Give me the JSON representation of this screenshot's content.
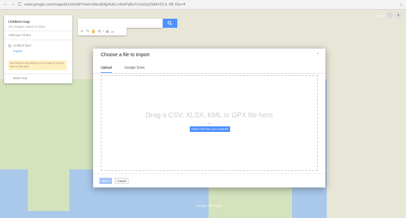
{
  "browser": {
    "url": "www.google.com/maps/d/u/0/edit?mid=zAbcdEfgHiJkLmNoPqRsTuVwXyZ0&ll=23.4,-98.7&z=4",
    "back_glyph": "←",
    "forward_glyph": "→",
    "reload_glyph": "C",
    "star_glyph": "☆"
  },
  "panel": {
    "title": "Untitled map",
    "subtitle": "All changes saved in Drive",
    "actions": "Add layer   Share",
    "layer_name": "Untitled layer",
    "import_link": "Import",
    "warning": "Add features by drawing on the map or import data to this layer",
    "base_map": "Base map"
  },
  "toolbar": {
    "icons": [
      "↶",
      "↷",
      "✋",
      "⚲",
      "∕",
      "⊞",
      "⚏"
    ]
  },
  "top_right": {
    "user": "Google",
    "apps_glyph": "⋮⋮",
    "avatar_glyph": "●"
  },
  "dialog": {
    "title": "Choose a file to import",
    "close_glyph": "×",
    "tabs": [
      "Upload",
      "Google Drive"
    ],
    "drop_text": "Drag a CSV, XLSX, KML or GPX file here",
    "or_text": "- Or -",
    "select_button": "Select a file from your computer",
    "footer_select": "Select",
    "footer_cancel": "Cancel"
  },
  "map": {
    "footer": "Google My Maps"
  },
  "colors": {
    "accent": "#4d90fe",
    "water": "#a9c8ea",
    "land": "#e8e6d7"
  }
}
